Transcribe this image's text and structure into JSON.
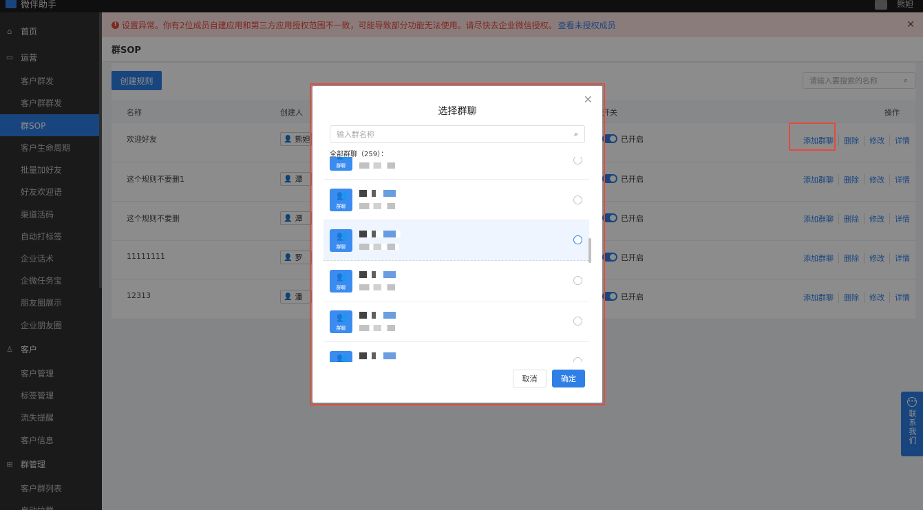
{
  "app": {
    "name": "微伴助手",
    "user": "熊妲"
  },
  "sidebar": {
    "groups": [
      {
        "label": "首页",
        "icon": "home-icon",
        "glyph": "⌂"
      },
      {
        "label": "运营",
        "icon": "operations-icon",
        "glyph": "▭"
      },
      {
        "label": "客户",
        "icon": "customer-icon",
        "glyph": "♙"
      },
      {
        "label": "群管理",
        "icon": "grid-icon",
        "glyph": "⊞"
      }
    ],
    "items": [
      "客户群发",
      "客户群群发",
      "群SOP",
      "客户生命周期",
      "批量加好友",
      "好友欢迎语",
      "渠道活码",
      "自动打标签",
      "企业话术",
      "企微任务宝",
      "朋友圈展示",
      "企业朋友圈",
      "客户管理",
      "标签管理",
      "流失提醒",
      "客户信息",
      "客户群列表",
      "自动拉群"
    ],
    "active": "群SOP"
  },
  "alert": {
    "text": "设置异常。你有2位成员自建应用和第三方应用授权范围不一致，可能导致部分功能无法使用。请尽快去企业微信授权。",
    "link": "查看未授权成员"
  },
  "page": {
    "title": "群SOP",
    "create_button": "创建规则",
    "search_placeholder": "请输入要搜索的名称"
  },
  "table": {
    "headers": {
      "name": "名称",
      "creator": "创建人",
      "switch": "开关",
      "actions": "操作"
    },
    "rows": [
      {
        "name": "欢迎好友",
        "creator": "熊妲",
        "status": "已开启"
      },
      {
        "name": "这个规则不要删1",
        "creator": "潭",
        "status": "已开启"
      },
      {
        "name": "这个规则不要删",
        "creator": "潭",
        "status": "已开启"
      },
      {
        "name": "11111111",
        "creator": "罗",
        "status": "已开启"
      },
      {
        "name": "12313",
        "creator": "潘",
        "status": "已开启"
      }
    ],
    "actions": [
      "添加群聊",
      "删除",
      "修改",
      "详情"
    ]
  },
  "modal": {
    "title": "选择群聊",
    "search_placeholder": "输入群名称",
    "count_label": "全部群聊（259）：",
    "avatar_label": "群聊",
    "cancel": "取消",
    "confirm": "确定"
  },
  "contact": {
    "label": "联系我们"
  }
}
